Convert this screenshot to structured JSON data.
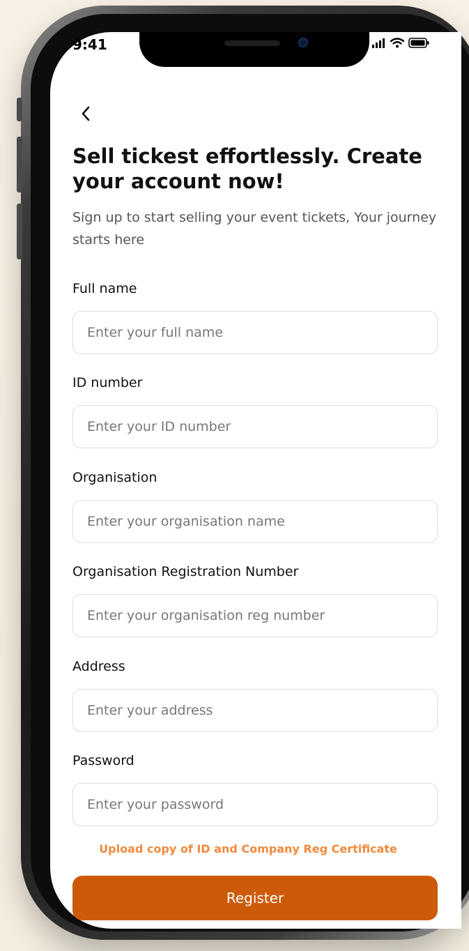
{
  "status_bar": {
    "time": "9:41",
    "icons": [
      "signal-icon",
      "wifi-icon",
      "battery-icon"
    ]
  },
  "header": {
    "back_icon": "chevron-left-icon",
    "title": "Sell tickest effortlessly. Create your account now!",
    "subtitle": "Sign up to start selling your event tickets, Your journey starts here"
  },
  "form": {
    "fields": [
      {
        "label": "Full name",
        "placeholder": "Enter your full name",
        "value": ""
      },
      {
        "label": "ID number",
        "placeholder": "Enter your ID number",
        "value": ""
      },
      {
        "label": "Organisation",
        "placeholder": "Enter your organisation name",
        "value": ""
      },
      {
        "label": "Organisation Registration Number",
        "placeholder": "Enter your organisation reg number",
        "value": ""
      },
      {
        "label": "Address",
        "placeholder": "Enter your address",
        "value": ""
      },
      {
        "label": "Password",
        "placeholder": "Enter your password",
        "value": ""
      }
    ],
    "upload_link": "Upload copy of ID and Company Reg Certificate",
    "submit_label": "Register"
  },
  "colors": {
    "accent": "#cc5a08",
    "link": "#f08a3c",
    "border": "#dcdcdc",
    "background": "#f6efe3"
  }
}
